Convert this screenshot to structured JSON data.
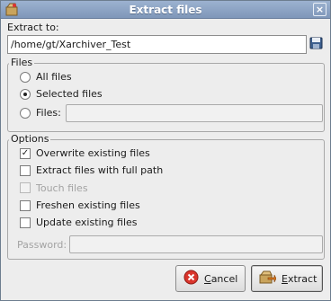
{
  "window": {
    "title": "Extract files"
  },
  "extract_to": {
    "label": "Extract to:",
    "path": "/home/gt/Xarchiver_Test"
  },
  "files_group": {
    "title": "Files",
    "options": [
      {
        "label": "All files",
        "selected": false
      },
      {
        "label": "Selected files",
        "selected": true
      },
      {
        "label": "Files:",
        "selected": false
      }
    ],
    "files_entry": ""
  },
  "options_group": {
    "title": "Options",
    "checks": [
      {
        "label": "Overwrite existing files",
        "checked": true,
        "enabled": true
      },
      {
        "label": "Extract files with full path",
        "checked": false,
        "enabled": true
      },
      {
        "label": "Touch files",
        "checked": false,
        "enabled": false
      },
      {
        "label": "Freshen existing files",
        "checked": false,
        "enabled": true
      },
      {
        "label": "Update existing files",
        "checked": false,
        "enabled": true
      }
    ],
    "password_label": "Password:",
    "password_value": ""
  },
  "buttons": {
    "cancel": {
      "mnemonic": "C",
      "rest": "ancel"
    },
    "extract": {
      "mnemonic": "E",
      "rest": "xtract"
    }
  },
  "icons": {
    "title": "archive-icon",
    "folder": "floppy-folder-icon",
    "cancel": "cancel-icon",
    "extract": "extract-icon"
  },
  "colors": {
    "titlebar": "#8aa3c4",
    "cancel_icon": "#d9342b"
  }
}
